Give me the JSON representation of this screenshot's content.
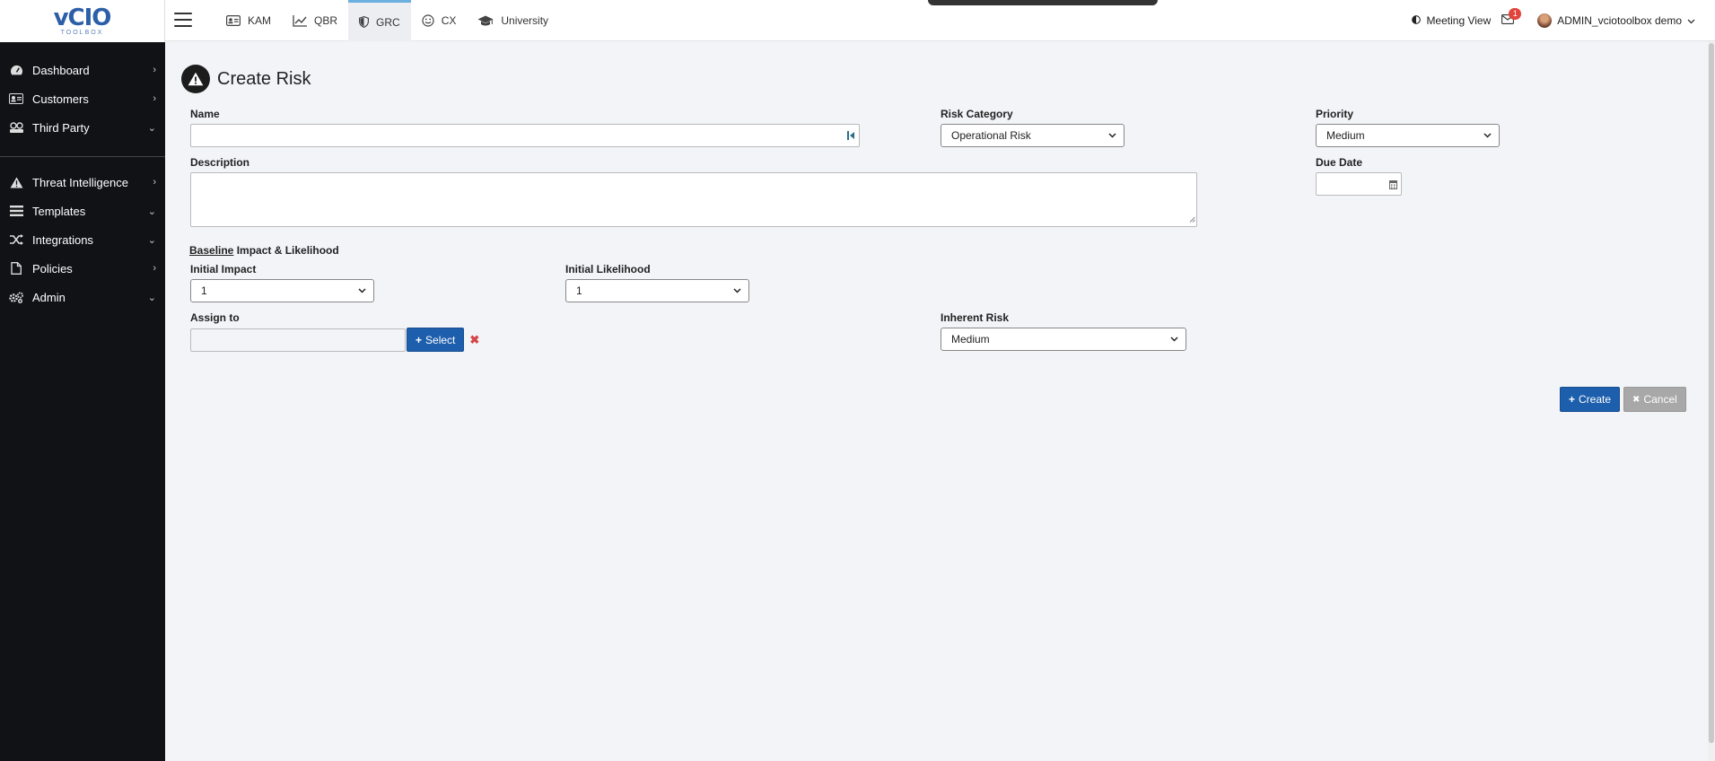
{
  "logo": {
    "mark": "vCIO",
    "sub": "TOOLBOX"
  },
  "sidebar": {
    "top_items": [
      {
        "label": "Dashboard",
        "chevron": "›"
      },
      {
        "label": "Customers",
        "chevron": "›"
      },
      {
        "label": "Third Party",
        "chevron": "⌄"
      }
    ],
    "bottom_items": [
      {
        "label": "Threat Intelligence",
        "chevron": "›"
      },
      {
        "label": "Templates",
        "chevron": "⌄"
      },
      {
        "label": "Integrations",
        "chevron": "⌄"
      },
      {
        "label": "Policies",
        "chevron": "›"
      },
      {
        "label": "Admin",
        "chevron": "⌄"
      }
    ]
  },
  "topbar": {
    "tabs": [
      {
        "label": "KAM",
        "icon": "id-card-icon"
      },
      {
        "label": "QBR",
        "icon": "line-chart-icon"
      },
      {
        "label": "GRC",
        "icon": "shield-icon",
        "active": true
      },
      {
        "label": "CX",
        "icon": "smile-icon"
      },
      {
        "label": "University",
        "icon": "graduation-cap-icon"
      }
    ],
    "meeting_view": "Meeting View",
    "notification_count": "1",
    "user_name": "ADMIN_vciotoolbox demo"
  },
  "page": {
    "title": "Create Risk",
    "name": {
      "label": "Name",
      "value": ""
    },
    "risk_category": {
      "label": "Risk Category",
      "value": "Operational Risk"
    },
    "priority": {
      "label": "Priority",
      "value": "Medium"
    },
    "description": {
      "label": "Description",
      "value": ""
    },
    "due_date": {
      "label": "Due Date",
      "value": ""
    },
    "baseline": {
      "underlined": "Baseline",
      "rest": " Impact & Likelihood"
    },
    "initial_impact": {
      "label": "Initial Impact",
      "value": "1"
    },
    "initial_likelihood": {
      "label": "Initial Likelihood",
      "value": "1"
    },
    "assign_to": {
      "label": "Assign to",
      "value": "",
      "select_label": "Select",
      "clear": "✖"
    },
    "inherent_risk": {
      "label": "Inherent Risk",
      "value": "Medium"
    },
    "create_label": "Create",
    "cancel_label": "Cancel"
  },
  "colors": {
    "primary": "#1d5fad",
    "sidebar": "#101216",
    "accent_tab": "#6cb0e0",
    "danger": "#d64545"
  }
}
